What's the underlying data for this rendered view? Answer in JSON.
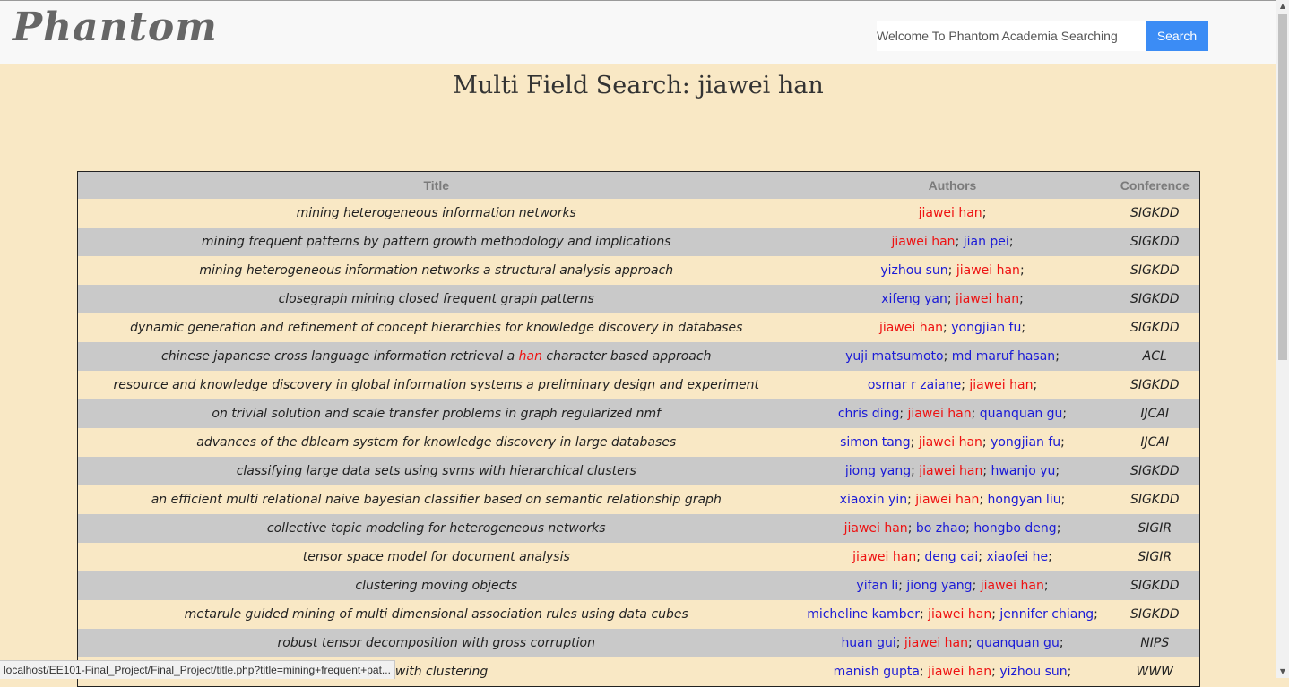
{
  "header": {
    "logo": "Phantom",
    "search_placeholder": "Welcome To Phantom Academia Searching",
    "search_button": "Search"
  },
  "page": {
    "title": "Multi Field Search: jiawei han"
  },
  "table": {
    "columns": [
      "Title",
      "Authors",
      "Conference"
    ],
    "rows": [
      {
        "title": [
          {
            "t": "mining heterogeneous information networks"
          }
        ],
        "authors": [
          {
            "name": "jiawei han",
            "hit": true,
            "sep": ";"
          }
        ],
        "conference": "SIGKDD"
      },
      {
        "title": [
          {
            "t": "mining frequent patterns by pattern growth methodology and implications"
          }
        ],
        "authors": [
          {
            "name": "jiawei han",
            "hit": true,
            "sep": ";"
          },
          {
            "name": "jian pei",
            "hit": false,
            "sep": ";"
          }
        ],
        "conference": "SIGKDD"
      },
      {
        "title": [
          {
            "t": "mining heterogeneous information networks a structural analysis approach"
          }
        ],
        "authors": [
          {
            "name": "yizhou sun",
            "hit": false,
            "sep": ";"
          },
          {
            "name": "jiawei han",
            "hit": true,
            "sep": ";"
          }
        ],
        "conference": "SIGKDD"
      },
      {
        "title": [
          {
            "t": "closegraph mining closed frequent graph patterns"
          }
        ],
        "authors": [
          {
            "name": "xifeng yan",
            "hit": false,
            "sep": ";"
          },
          {
            "name": "jiawei han",
            "hit": true,
            "sep": ";"
          }
        ],
        "conference": "SIGKDD"
      },
      {
        "title": [
          {
            "t": "dynamic generation and refinement of concept hierarchies for knowledge discovery in databases"
          }
        ],
        "authors": [
          {
            "name": "jiawei han",
            "hit": true,
            "sep": ";"
          },
          {
            "name": "yongjian fu",
            "hit": false,
            "sep": ";"
          }
        ],
        "conference": "SIGKDD"
      },
      {
        "title": [
          {
            "t": "chinese japanese cross language information retrieval a "
          },
          {
            "t": "han",
            "hl": true
          },
          {
            "t": " character based approach"
          }
        ],
        "authors": [
          {
            "name": "yuji matsumoto",
            "hit": false,
            "sep": ";"
          },
          {
            "name": "md maruf hasan",
            "hit": false,
            "sep": ";"
          }
        ],
        "conference": "ACL"
      },
      {
        "title": [
          {
            "t": "resource and knowledge discovery in global information systems a preliminary design and experiment"
          }
        ],
        "authors": [
          {
            "name": "osmar r zaiane",
            "hit": false,
            "sep": ";"
          },
          {
            "name": "jiawei han",
            "hit": true,
            "sep": ";"
          }
        ],
        "conference": "SIGKDD"
      },
      {
        "title": [
          {
            "t": "on trivial solution and scale transfer problems in graph regularized nmf"
          }
        ],
        "authors": [
          {
            "name": "chris ding",
            "hit": false,
            "sep": ";"
          },
          {
            "name": "jiawei han",
            "hit": true,
            "sep": ";"
          },
          {
            "name": "quanquan gu",
            "hit": false,
            "sep": ";"
          }
        ],
        "conference": "IJCAI"
      },
      {
        "title": [
          {
            "t": "advances of the dblearn system for knowledge discovery in large databases"
          }
        ],
        "authors": [
          {
            "name": "simon tang",
            "hit": false,
            "sep": ";"
          },
          {
            "name": "jiawei han",
            "hit": true,
            "sep": ";"
          },
          {
            "name": "yongjian fu",
            "hit": false,
            "sep": ";"
          }
        ],
        "conference": "IJCAI"
      },
      {
        "title": [
          {
            "t": "classifying large data sets using svms with hierarchical clusters"
          }
        ],
        "authors": [
          {
            "name": "jiong yang",
            "hit": false,
            "sep": ";"
          },
          {
            "name": "jiawei han",
            "hit": true,
            "sep": ";"
          },
          {
            "name": "hwanjo yu",
            "hit": false,
            "sep": ";"
          }
        ],
        "conference": "SIGKDD"
      },
      {
        "title": [
          {
            "t": "an efficient multi relational naive bayesian classifier based on semantic relationship graph"
          }
        ],
        "authors": [
          {
            "name": "xiaoxin yin",
            "hit": false,
            "sep": ";"
          },
          {
            "name": "jiawei han",
            "hit": true,
            "sep": ";"
          },
          {
            "name": "hongyan liu",
            "hit": false,
            "sep": ";"
          }
        ],
        "conference": "SIGKDD"
      },
      {
        "title": [
          {
            "t": "collective topic modeling for heterogeneous networks"
          }
        ],
        "authors": [
          {
            "name": "jiawei han",
            "hit": true,
            "sep": ";"
          },
          {
            "name": "bo zhao",
            "hit": false,
            "sep": ";"
          },
          {
            "name": "hongbo deng",
            "hit": false,
            "sep": ";"
          }
        ],
        "conference": "SIGIR"
      },
      {
        "title": [
          {
            "t": "tensor space model for document analysis"
          }
        ],
        "authors": [
          {
            "name": "jiawei han",
            "hit": true,
            "sep": ";"
          },
          {
            "name": "deng cai",
            "hit": false,
            "sep": ";"
          },
          {
            "name": "xiaofei he",
            "hit": false,
            "sep": ";"
          }
        ],
        "conference": "SIGIR"
      },
      {
        "title": [
          {
            "t": "clustering moving objects"
          }
        ],
        "authors": [
          {
            "name": "yifan li",
            "hit": false,
            "sep": ";"
          },
          {
            "name": "jiong yang",
            "hit": false,
            "sep": ";"
          },
          {
            "name": "jiawei han",
            "hit": true,
            "sep": ";"
          }
        ],
        "conference": "SIGKDD"
      },
      {
        "title": [
          {
            "t": "metarule guided mining of multi dimensional association rules using data cubes"
          }
        ],
        "authors": [
          {
            "name": "micheline kamber",
            "hit": false,
            "sep": ";"
          },
          {
            "name": "jiawei han",
            "hit": true,
            "sep": ";"
          },
          {
            "name": "jennifer chiang",
            "hit": false,
            "sep": ";"
          }
        ],
        "conference": "SIGKDD"
      },
      {
        "title": [
          {
            "t": "robust tensor decomposition with gross corruption"
          }
        ],
        "authors": [
          {
            "name": "huan gui",
            "hit": false,
            "sep": ";"
          },
          {
            "name": "jiawei han",
            "hit": true,
            "sep": ";"
          },
          {
            "name": "quanquan gu",
            "hit": false,
            "sep": ";"
          }
        ],
        "conference": "NIPS"
      },
      {
        "title": [
          {
            "t": "s with clustering"
          }
        ],
        "authors": [
          {
            "name": "manish gupta",
            "hit": false,
            "sep": ";"
          },
          {
            "name": "jiawei han",
            "hit": true,
            "sep": ";"
          },
          {
            "name": "yizhou sun",
            "hit": false,
            "sep": ";"
          }
        ],
        "conference": "WWW"
      }
    ]
  },
  "status_bar": {
    "url": "localhost/EE101-Final_Project/Final_Project/title.php?title=mining+frequent+pat..."
  },
  "scrollbar": {
    "position_fraction": 0.0,
    "visible_fraction": 0.53
  }
}
